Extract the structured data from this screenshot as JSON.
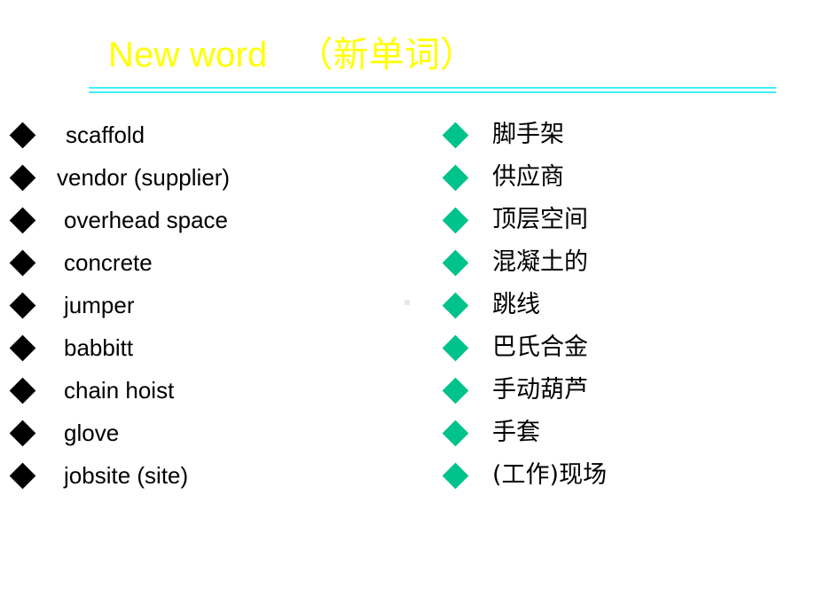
{
  "slide": {
    "title": "New word   （新单词）",
    "accent_yellow": "#ffff00",
    "accent_cyan": "#3ef0ff",
    "bullet_black": "#000000",
    "bullet_green": "#00c38b",
    "background": "#ffffff"
  },
  "left_column": {
    "items": [
      {
        "term": "scaffold"
      },
      {
        "term": "vendor (supplier)"
      },
      {
        "term": "overhead space"
      },
      {
        "term": "concrete"
      },
      {
        "term": "jumper"
      },
      {
        "term": "babbitt"
      },
      {
        "term": "chain hoist"
      },
      {
        "term": "glove"
      },
      {
        "term": "jobsite (site)"
      }
    ]
  },
  "right_column": {
    "items": [
      {
        "term": "脚手架"
      },
      {
        "term": "供应商"
      },
      {
        "term": "顶层空间"
      },
      {
        "term": "混凝土的"
      },
      {
        "term": "跳线"
      },
      {
        "term": "巴氏合金"
      },
      {
        "term": "手动葫芦"
      },
      {
        "term": "手套"
      },
      {
        "term": "(工作)现场"
      }
    ]
  }
}
